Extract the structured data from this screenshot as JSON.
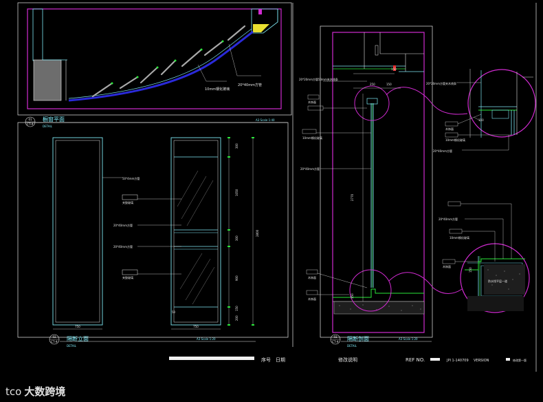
{
  "plan": {
    "title": "橱窗平面",
    "sub": "DETAIL",
    "num": "01",
    "num_sub": "CT-#",
    "scale": "A3 Scale 1:40",
    "note1": "20*40mm方管",
    "note2": "10mm钢化玻璃"
  },
  "elevation": {
    "title": "隔断立面",
    "sub": "DETAIL",
    "num": "02",
    "num_sub": "CT-#",
    "scale": "A3 Scale 1:20",
    "note_frame": "50*4mm方管",
    "note_glass1": "夹胶玻璃",
    "note_tube1": "20*40mm方管",
    "note_tube2": "20*40mm方管",
    "note_glass2": "夹胶玻璃",
    "dims_right": [
      "300",
      "1050",
      "300",
      "900",
      "150",
      "200"
    ],
    "dim_total": "2800",
    "width1": "750",
    "width2": "750",
    "small_dim": "50"
  },
  "section": {
    "title": "隔断剖面",
    "sub": "DETAIL",
    "num": "03",
    "num_sub": "CT-#",
    "scale": "A3 Scale 1:20",
    "note_a": "20*20mm方管50mm夹木线条",
    "note_b": "木饰面",
    "note_c": "10mm钢化玻璃",
    "note_d": "20*40mm方管",
    "note_e": "木饰面",
    "note_f": "木饰面",
    "dim_top1": "150",
    "dim_top2": "250",
    "dim_top3": "150",
    "dim_mid": "2770",
    "dim_bot": "150"
  },
  "detail1": {
    "note_a": "20*20mm方管夹木线条",
    "note_b": "木饰面",
    "note_c": "10mm钢化玻璃",
    "note_d": "20*40mm方管",
    "dim": "150"
  },
  "detail2": {
    "note_a": "20*40mm方管",
    "note_b": "10mm钢化玻璃",
    "note_c": "木饰面",
    "note_d": "防水找平层一道",
    "dim": "150"
  },
  "titleblock": {
    "seq_label": "序号",
    "date_label": "日期",
    "rev_label": "修改说明",
    "ref_label": "REF NO.",
    "ref_value": "JPI 1-140709",
    "version_label": "VERSION",
    "version_value": "修改第一版"
  },
  "watermark": {
    "logo": "tco",
    "text": "大数跨境"
  }
}
